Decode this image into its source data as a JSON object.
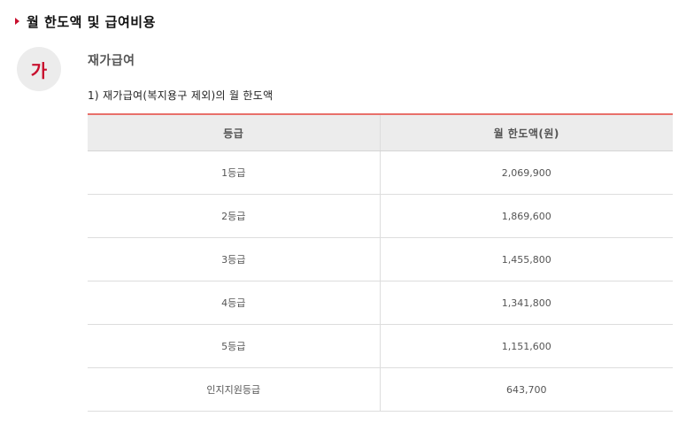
{
  "heading": {
    "title": "월 한도액 및 급여비용",
    "arrow_icon": "triangle-right-icon",
    "accent_color": "#c8102e"
  },
  "section": {
    "badge": "가",
    "title": "재가급여",
    "caption": "1) 재가급여(복지용구 제외)의 월 한도액"
  },
  "table": {
    "columns": [
      "등급",
      "월 한도액(원)"
    ],
    "rows": [
      {
        "grade": "1등급",
        "amount": "2,069,900"
      },
      {
        "grade": "2등급",
        "amount": "1,869,600"
      },
      {
        "grade": "3등급",
        "amount": "1,455,800"
      },
      {
        "grade": "4등급",
        "amount": "1,341,800"
      },
      {
        "grade": "5등급",
        "amount": "1,151,600"
      },
      {
        "grade": "인지지원등급",
        "amount": "643,700"
      }
    ],
    "top_border_color": "#e8706a"
  }
}
